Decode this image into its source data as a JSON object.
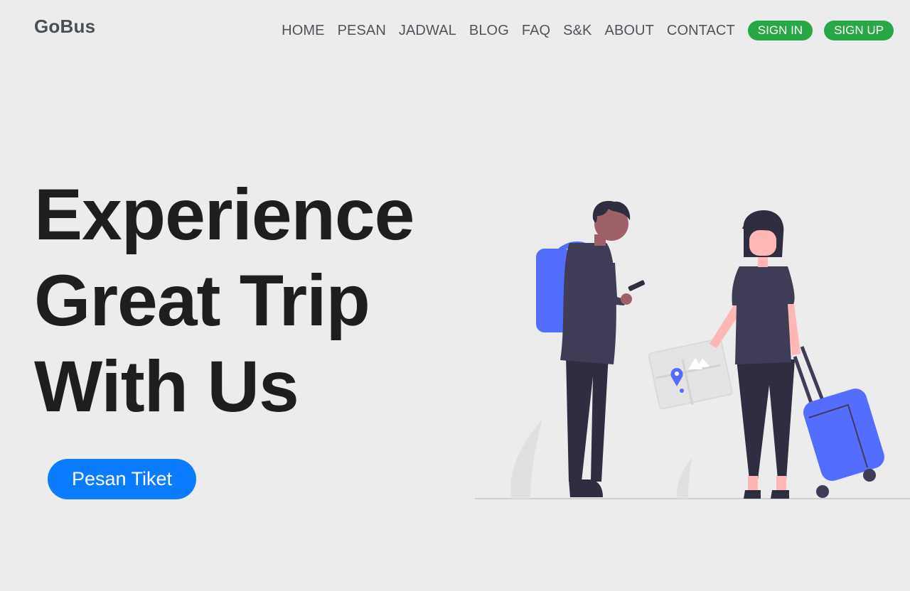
{
  "header": {
    "brand": "GoBus",
    "nav": [
      {
        "label": "HOME",
        "name": "nav-home"
      },
      {
        "label": "PESAN",
        "name": "nav-pesan"
      },
      {
        "label": "JADWAL",
        "name": "nav-jadwal"
      },
      {
        "label": "BLOG",
        "name": "nav-blog"
      },
      {
        "label": "FAQ",
        "name": "nav-faq"
      },
      {
        "label": "S&K",
        "name": "nav-snk"
      },
      {
        "label": "ABOUT",
        "name": "nav-about"
      },
      {
        "label": "CONTACT",
        "name": "nav-contact"
      }
    ],
    "sign_in": "SIGN IN",
    "sign_up": "SIGN UP"
  },
  "hero": {
    "title_lines": [
      "Experience",
      "Great Trip",
      "With Us"
    ],
    "cta": "Pesan Tiket"
  },
  "colors": {
    "background": "#ececec",
    "accent_green": "#28a745",
    "cta_blue": "#0b7cff",
    "illustration_blue": "#536dfe",
    "illustration_dark": "#3f3d56",
    "title": "#1e1e1e"
  },
  "illustration": {
    "icon": "travelers-illustration"
  }
}
